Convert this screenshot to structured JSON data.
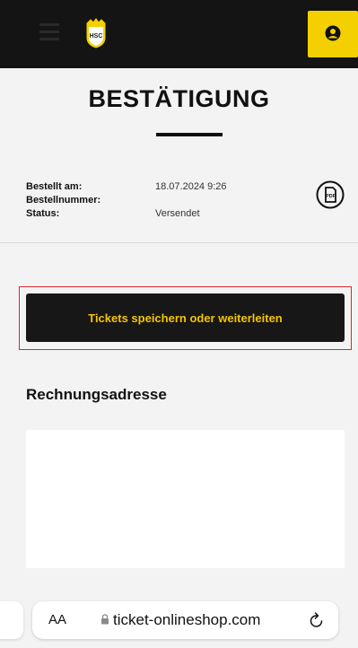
{
  "header": {
    "logo_text": "HSC",
    "colors": {
      "bar": "#141414",
      "accent": "#f5d000"
    },
    "menu_icon": "hamburger-icon",
    "user_icon": "user-icon"
  },
  "page": {
    "title": "BESTÄTIGUNG"
  },
  "order": {
    "rows": [
      {
        "label": "Bestellt am:",
        "value": "18.07.2024 9:26"
      },
      {
        "label": "Bestellnummer:",
        "value": ""
      },
      {
        "label": "Status:",
        "value": "Versendet"
      }
    ],
    "pdf_icon": "pdf-download-icon",
    "pdf_label": "PDF"
  },
  "tickets": {
    "button_label": "Tickets speichern oder weiterleiten",
    "highlight_color": "#d9282e"
  },
  "billing": {
    "heading": "Rechnungsadresse"
  },
  "browser": {
    "text_size_label": "AA",
    "url": "ticket-onlineshop.com",
    "lock_icon": "lock-icon",
    "reload_icon": "reload-icon"
  }
}
